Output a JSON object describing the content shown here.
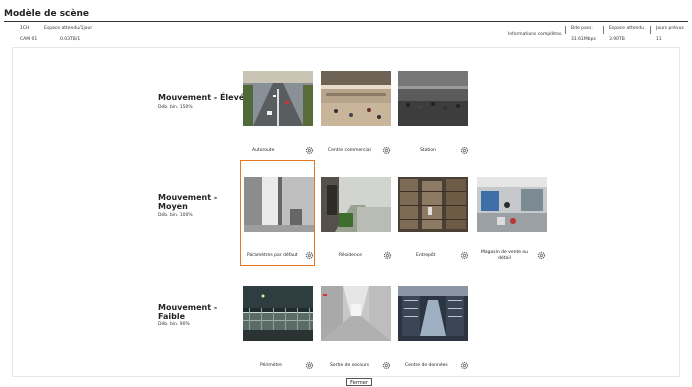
{
  "window": {
    "title": "Modèle de scène"
  },
  "summary": {
    "channel_header": "1CH",
    "space_header": "Espace attendu/1jour",
    "channel_value": "CAM 01",
    "space_value": "0.03TB/1",
    "info_label": "Informations complètes.",
    "bitrate_header": "Bde pass.",
    "bitrate_value": "31.61Mbps",
    "expected_header": "Espace attendu",
    "expected_value": "3.90TB",
    "days_header": "Jours prévus",
    "days_value": "11"
  },
  "sections": [
    {
      "title": "Mouvement - Élevé",
      "sub": "Déb. bin.   150%",
      "scenes": [
        {
          "label": "Autoroute"
        },
        {
          "label": "Centre commercial"
        },
        {
          "label": "Station"
        }
      ]
    },
    {
      "title": "Mouvement - Moyen",
      "sub": "Déb. bin.   100%",
      "scenes": [
        {
          "label": "Paramètres par défaut"
        },
        {
          "label": "Résidence"
        },
        {
          "label": "Entrepôt"
        },
        {
          "label": "Magasin de vente ou détail"
        }
      ]
    },
    {
      "title": "Mouvement - Faible",
      "sub": "Déb. bin.   90%",
      "scenes": [
        {
          "label": "Périmètre"
        },
        {
          "label": "Sortie de secours"
        },
        {
          "label": "Centre de données"
        }
      ]
    }
  ],
  "selected_scene": "Paramètres par défaut",
  "accent_color": "#e87722",
  "icons": {
    "settings": "gear-icon"
  },
  "footer": {
    "close_label": "Fermer"
  }
}
